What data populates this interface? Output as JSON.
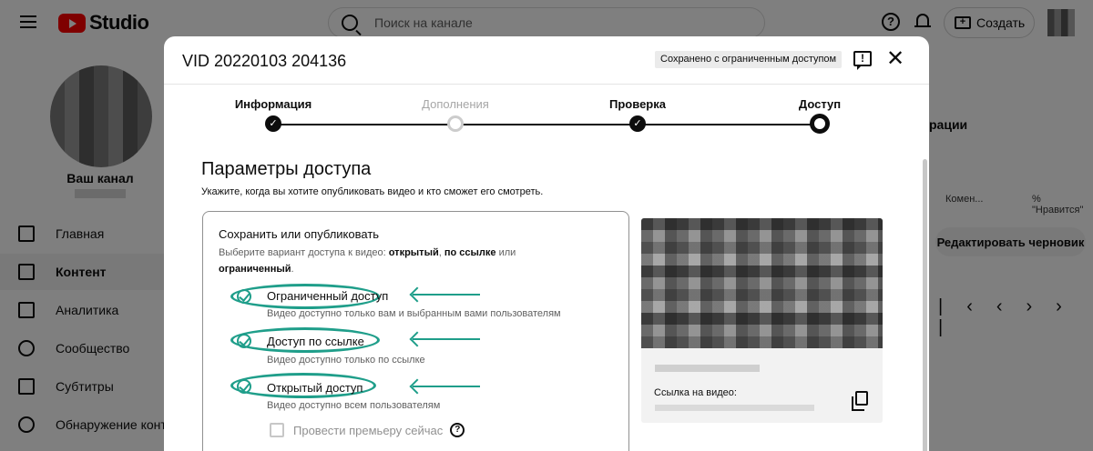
{
  "topbar": {
    "logo_text": "Studio",
    "search_placeholder": "Поиск на канале",
    "create_label": "Создать"
  },
  "sidebar": {
    "channel_name": "Ваш канал",
    "items": [
      {
        "label": "Главная",
        "icon": "dashboard-icon"
      },
      {
        "label": "Контент",
        "icon": "content-icon",
        "active": true
      },
      {
        "label": "Аналитика",
        "icon": "analytics-icon"
      },
      {
        "label": "Сообщество",
        "icon": "community-icon"
      },
      {
        "label": "Субтитры",
        "icon": "subtitles-icon"
      },
      {
        "label": "Обнаружение конте",
        "icon": "copyright-icon"
      }
    ]
  },
  "background_table": {
    "header_partial": "рации",
    "col_comments": "Комен...",
    "col_likes": "% \"Нравится\"",
    "edit_draft_label": "Редактировать черновик"
  },
  "dialog": {
    "title": "VID 20220103 204136",
    "save_status": "Сохранено с ограниченным доступом",
    "steps": [
      {
        "label": "Информация",
        "state": "done"
      },
      {
        "label": "Дополнения",
        "state": "pending"
      },
      {
        "label": "Проверка",
        "state": "done"
      },
      {
        "label": "Доступ",
        "state": "current"
      }
    ],
    "section_title": "Параметры доступа",
    "section_desc": "Укажите, когда вы хотите опубликовать видео и кто сможет его смотреть.",
    "save_box": {
      "title": "Сохранить или опубликовать",
      "desc_prefix": "Выберите вариант доступа к видео: ",
      "opt_public_bold": "открытый",
      "desc_sep": ", ",
      "opt_link_bold": "по ссылке",
      "desc_or": " или",
      "opt_private_bold": "ограниченный",
      "desc_end": ".",
      "options": [
        {
          "label": "Ограниченный доступ",
          "sub": "Видео доступно только вам и выбранным вами пользователям"
        },
        {
          "label": "Доступ по ссылке",
          "sub": "Видео доступно только по ссылке"
        },
        {
          "label": "Открытый доступ",
          "sub": "Видео доступно всем пользователям"
        }
      ],
      "premiere_label": "Провести премьеру сейчас"
    },
    "preview": {
      "link_label": "Ссылка на видео:"
    },
    "accent_color": "#1f9e8a"
  }
}
